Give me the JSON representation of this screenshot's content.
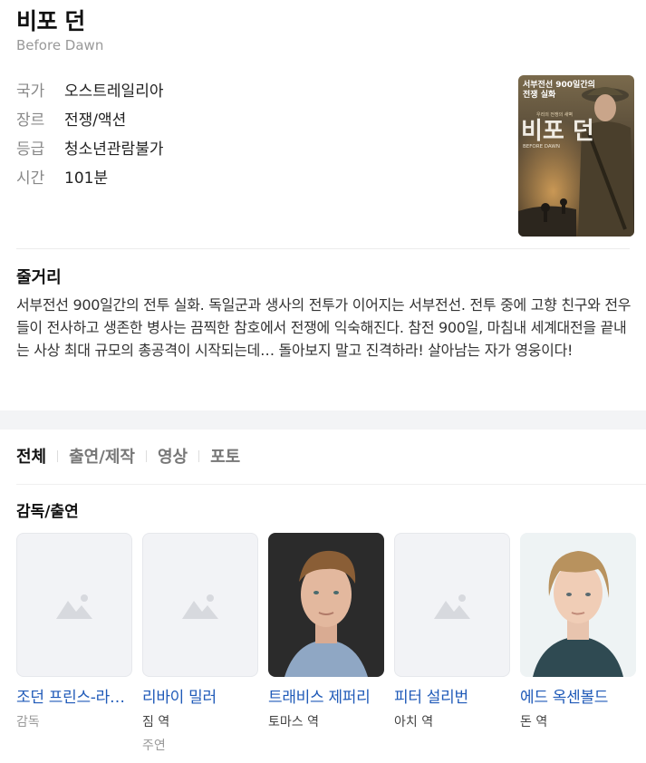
{
  "movie": {
    "title": "비포 던",
    "original_title": "Before Dawn",
    "info": [
      {
        "label": "국가",
        "value": "오스트레일리아"
      },
      {
        "label": "장르",
        "value": "전쟁/액션"
      },
      {
        "label": "등급",
        "value": "청소년관람불가"
      },
      {
        "label": "시간",
        "value": "101분"
      }
    ],
    "poster": {
      "tagline": "서부전선 900일간의",
      "tagline2": "전쟁 실화",
      "small_text": "우리의 전쟁의 새벽",
      "poster_title": "비포 던",
      "poster_subtitle": "BEFORE DAWN",
      "colors": {
        "bg_top": "#6b5a3c",
        "bg_bottom": "#3a2f22",
        "accent": "#b8884a"
      }
    },
    "plot_heading": "줄거리",
    "plot": "서부전선 900일간의 전투 실화. 독일군과 생사의 전투가 이어지는 서부전선. 전투 중에 고향 친구와 전우들이 전사하고 생존한 병사는 끔찍한 참호에서 전쟁에 익숙해진다. 참전 900일, 마침내 세계대전을 끝내는 사상 최대 규모의 총공격이 시작되는데… 돌아보지 말고 진격하라! 살아남는 자가 영웅이다!"
  },
  "tabs": [
    {
      "label": "전체",
      "active": true
    },
    {
      "label": "출연/제작",
      "active": false
    },
    {
      "label": "영상",
      "active": false
    },
    {
      "label": "포토",
      "active": false
    }
  ],
  "cast_section": {
    "heading": "감독/출연",
    "people": [
      {
        "name": "조던 프린스-라이트",
        "role": "감독",
        "sub": ""
      },
      {
        "name": "리바이 밀러",
        "role": "짐 역",
        "sub": "주연"
      },
      {
        "name": "트래비스 제퍼리",
        "role": "토마스 역",
        "sub": ""
      },
      {
        "name": "피터 설리번",
        "role": "아치 역",
        "sub": ""
      },
      {
        "name": "에드 옥센볼드",
        "role": "돈 역",
        "sub": ""
      }
    ]
  },
  "colors": {
    "link": "#1f5ab8",
    "placeholder_bg": "#f2f3f6",
    "placeholder_icon": "#d7d9de"
  }
}
